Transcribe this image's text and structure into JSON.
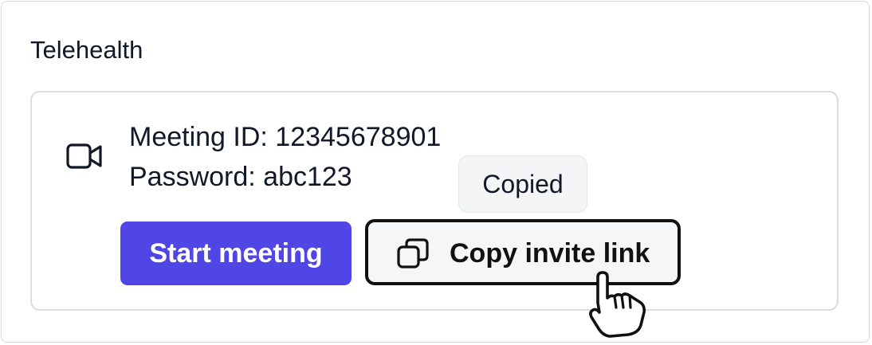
{
  "section": {
    "title": "Telehealth"
  },
  "meeting": {
    "id_text": "Meeting ID: 12345678901",
    "password_text": "Password: abc123"
  },
  "tooltip": {
    "text": "Copied"
  },
  "buttons": {
    "start_label": "Start meeting",
    "copy_label": "Copy invite link"
  },
  "icons": {
    "video": "video-camera-icon",
    "copy": "copy-icon",
    "cursor": "hand-pointer-cursor-icon"
  },
  "colors": {
    "primary": "#4f46e5",
    "text": "#111827",
    "border": "#d9dce1",
    "tooltip_bg": "#f4f5f7"
  }
}
